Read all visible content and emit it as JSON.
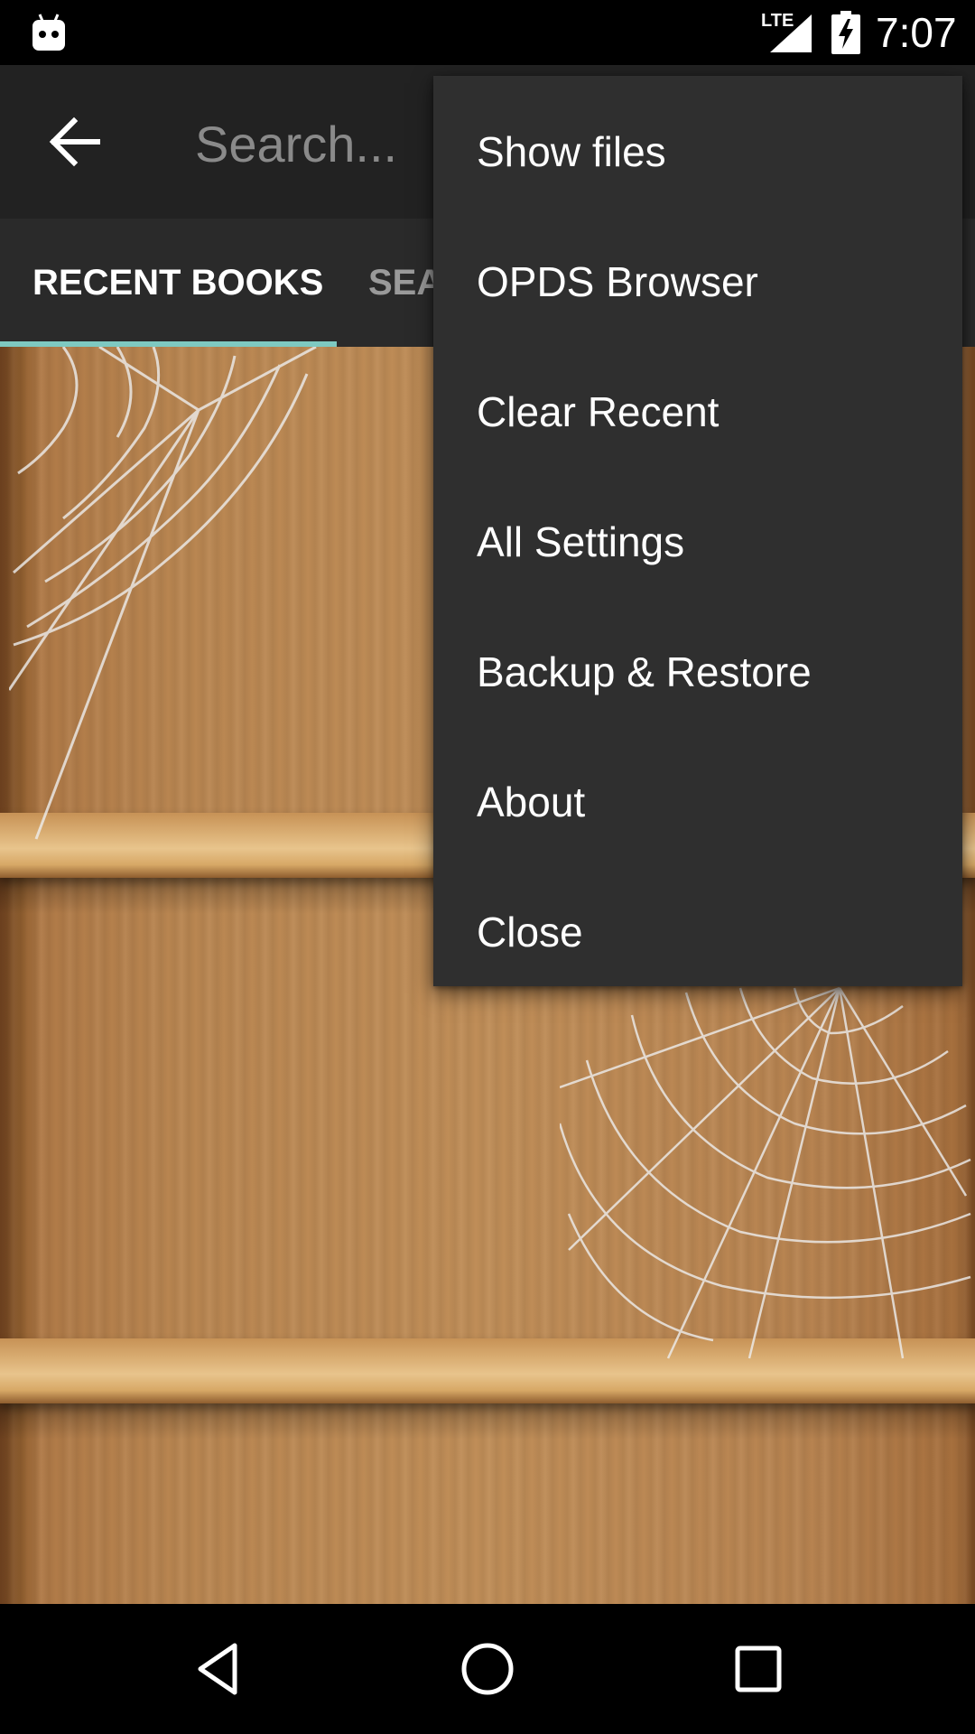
{
  "status_bar": {
    "network": "LTE",
    "time": "7:07",
    "icons": [
      "android-notification-icon",
      "signal-icon",
      "battery-charging-icon"
    ]
  },
  "toolbar": {
    "back_icon": "arrow-left-icon",
    "search_placeholder": "Search..."
  },
  "tabs": [
    {
      "label": "RECENT BOOKS",
      "selected": true
    },
    {
      "label": "SEA",
      "selected": false
    }
  ],
  "menu": {
    "items": [
      {
        "label": "Show files"
      },
      {
        "label": "OPDS Browser"
      },
      {
        "label": "Clear Recent"
      },
      {
        "label": "All Settings"
      },
      {
        "label": "Backup & Restore"
      },
      {
        "label": "About"
      },
      {
        "label": "Close"
      }
    ]
  },
  "nav_bar": {
    "icons": [
      "back-triangle-icon",
      "home-circle-icon",
      "recents-square-icon"
    ]
  },
  "colors": {
    "tab_indicator": "#7ec9c1",
    "menu_background": "#2f2f2f",
    "toolbar_background": "#222222"
  }
}
